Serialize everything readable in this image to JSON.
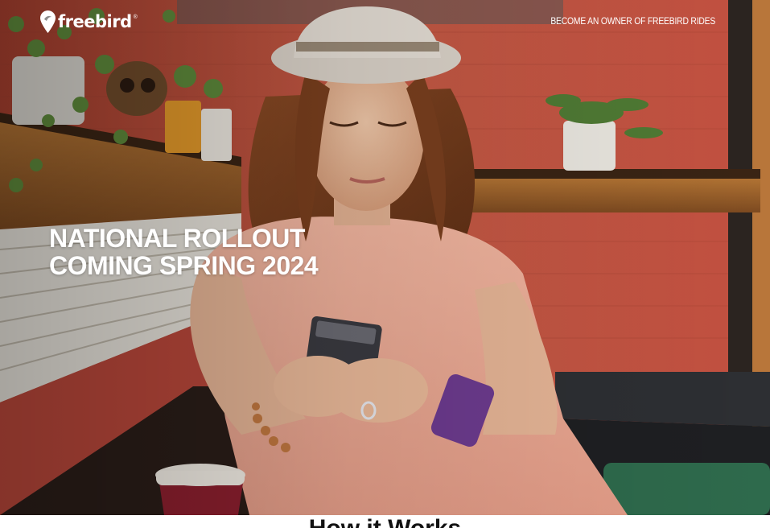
{
  "header": {
    "logo_text": "freebird",
    "logo_trademark": "®",
    "nav_link": "BECOME AN OWNER OF FREEBIRD RIDES"
  },
  "hero": {
    "headline_line1": "NATIONAL ROLLOUT",
    "headline_line2": "COMING SPRING 2024"
  },
  "how_it_works": {
    "title": "How it Works"
  },
  "colors": {
    "text_on_hero": "#ffffff",
    "wall_red": "#c0503d",
    "shelf_wood": "#9a5a2a",
    "section_title": "#111111"
  }
}
